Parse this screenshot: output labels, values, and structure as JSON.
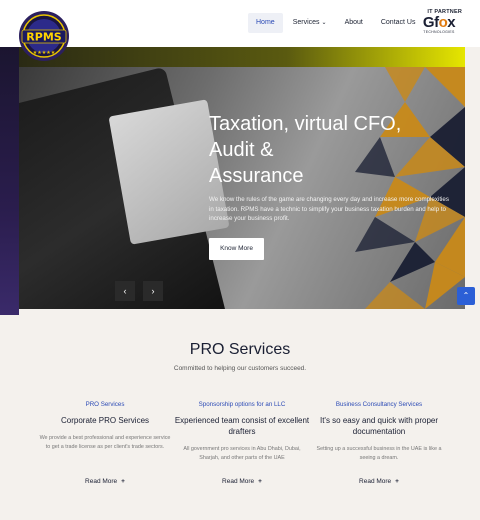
{
  "brand": {
    "logo_text": "RPMS"
  },
  "nav": {
    "items": [
      {
        "label": "Home",
        "active": true
      },
      {
        "label": "Services",
        "has_dropdown": true
      },
      {
        "label": "About"
      },
      {
        "label": "Contact Us"
      }
    ]
  },
  "partner": {
    "top": "IT PARTNER",
    "brand_pre": "Gf",
    "brand_o": "o",
    "brand_post": "x",
    "sub": "TECHNOLOGIES"
  },
  "hero": {
    "title_line1": "Taxation, virtual CFO,",
    "title_line2": "Audit &",
    "title_line3": "Assurance",
    "text": "We know the rules of the game are changing every day and increase more complexities in taxation. RPMS have a technic to simplify your business taxation burden and help to increase your business profit.",
    "button": "Know More",
    "prev_icon": "chevron-left-icon",
    "next_icon": "chevron-right-icon"
  },
  "scroll_top": {
    "icon": "chevron-up-icon"
  },
  "services": {
    "title": "PRO Services",
    "subtitle": "Committed to helping our customers succeed.",
    "columns": [
      {
        "kicker": "PRO Services",
        "heading": "Corporate PRO Services",
        "text": "We provide a best professional and experience service to get a trade license as per client's trade sectors.",
        "link": "Read More"
      },
      {
        "kicker": "Sponsorship options for an LLC",
        "heading": "Experienced team consist of excellent drafters",
        "text": "All government pro services in Abu Dhabi, Dubai, Sharjah, and other parts of the UAE",
        "link": "Read More"
      },
      {
        "kicker": "Business Consultancy Services",
        "heading": "It's so easy and quick with proper documentation",
        "text": "Setting up a successful business in the UAE is like a seeing a dream.",
        "link": "Read More"
      }
    ]
  },
  "colors": {
    "accent": "#2b4ab5",
    "hero_button_bg": "#ffffff",
    "triangle_gold": "#c98a1a",
    "scroll_top_bg": "#2b5fd6"
  }
}
